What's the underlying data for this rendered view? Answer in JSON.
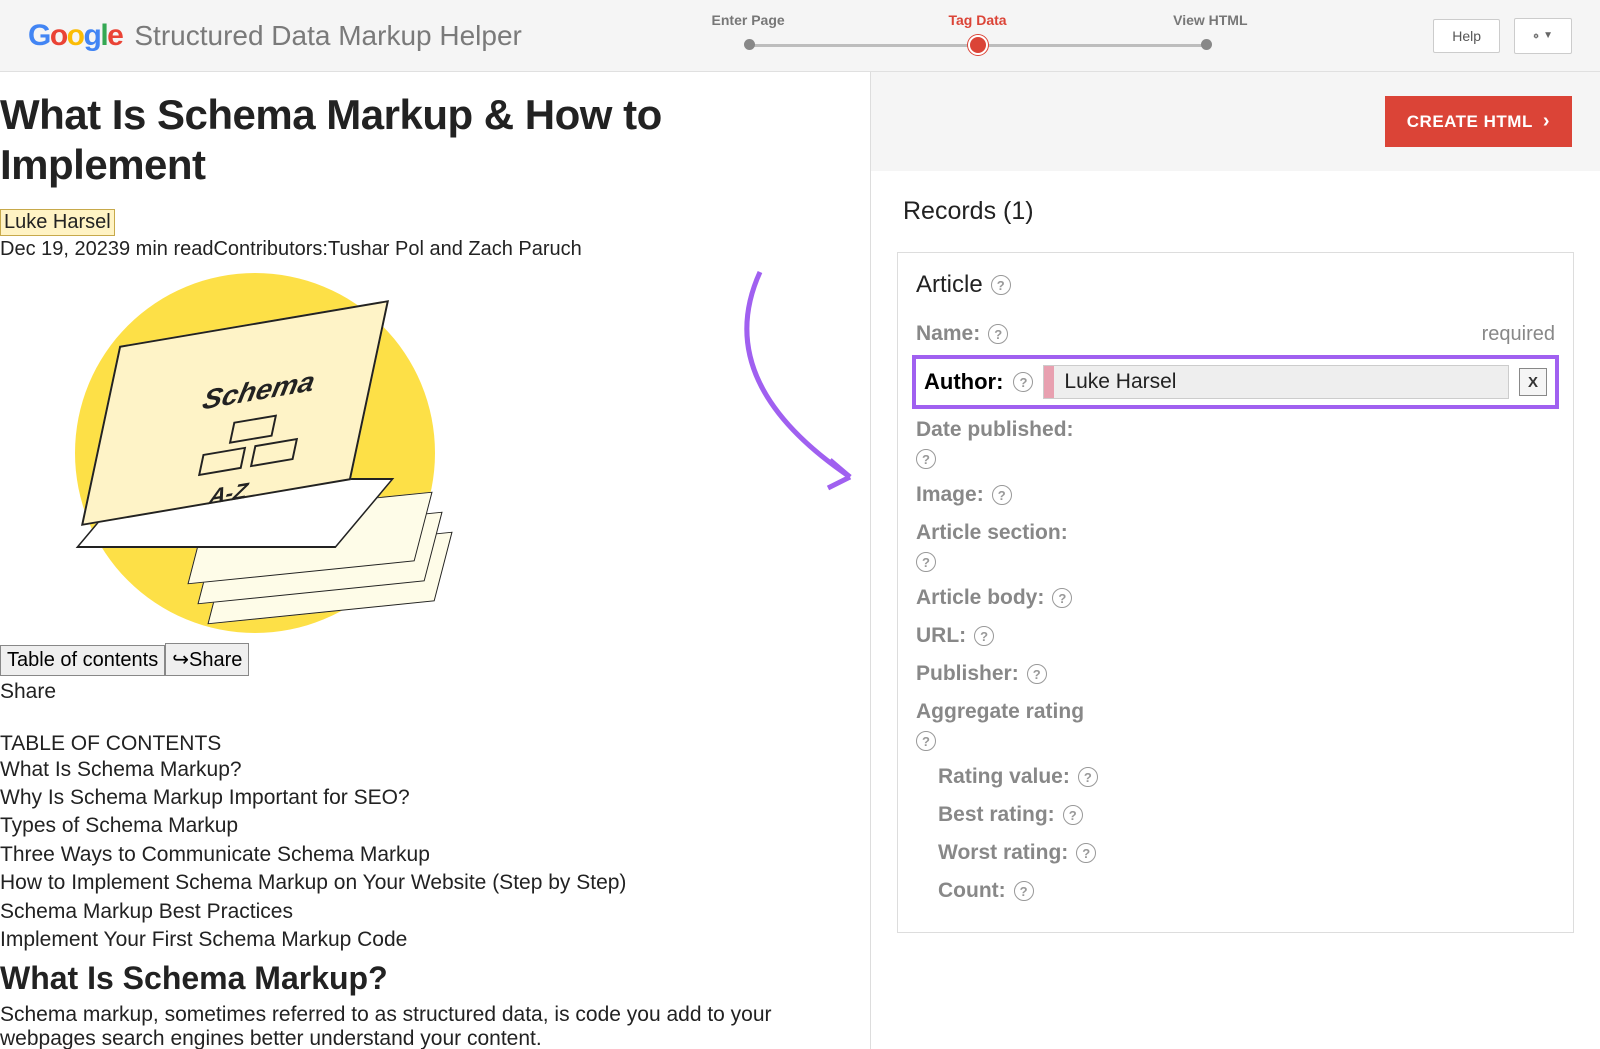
{
  "header": {
    "app_title": "Structured Data Markup Helper",
    "steps": [
      "Enter Page",
      "Tag Data",
      "View HTML"
    ],
    "help_label": "Help"
  },
  "article": {
    "title": "What Is Schema Markup & How to Implement",
    "highlighted_author": "Luke Harsel",
    "meta_line": "Dec 19, 20239 min readContributors:Tushar Pol and Zach Paruch",
    "illustration_top_text": "Schema",
    "illustration_bottom_text": "A-Z",
    "toc_button": "Table of contents",
    "share_button": "Share",
    "share_line": "Share",
    "toc_heading": "TABLE OF CONTENTS",
    "toc_items": [
      "What Is Schema Markup?",
      "Why Is Schema Markup Important for SEO?",
      "Types of Schema Markup",
      "Three Ways to Communicate Schema Markup",
      "How to Implement Schema Markup on Your Website (Step by Step)",
      "Schema Markup Best Practices",
      "Implement Your First Schema Markup Code"
    ],
    "sub_heading": "What Is Schema Markup?",
    "body_text": "Schema markup, sometimes referred to as structured data, is code you add to your webpages search engines better understand your content."
  },
  "right": {
    "create_html": "CREATE HTML",
    "records_title": "Records (1)",
    "record_type": "Article",
    "required_label": "required",
    "author_value": "Luke Harsel",
    "x_label": "X",
    "fields": {
      "name": "Name:",
      "author": "Author:",
      "date_published": "Date published:",
      "image": "Image:",
      "article_section": "Article section:",
      "article_body": "Article body:",
      "url": "URL:",
      "publisher": "Publisher:",
      "aggregate_rating": "Aggregate rating",
      "rating_value": "Rating value:",
      "best_rating": "Best rating:",
      "worst_rating": "Worst rating:",
      "count": "Count:"
    }
  }
}
